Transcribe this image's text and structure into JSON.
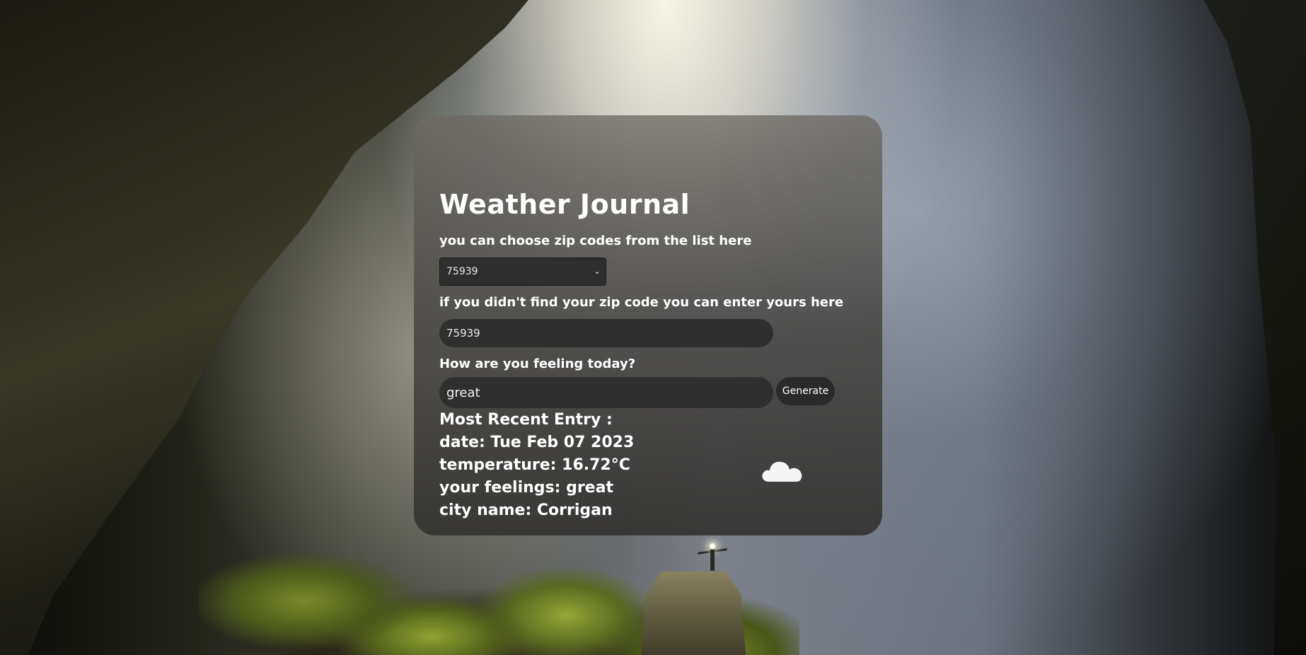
{
  "app": {
    "title": "Weather Journal"
  },
  "zip_list": {
    "label": "you can choose zip codes from the list here",
    "selected": "75939"
  },
  "zip_entry": {
    "label": "if you didn't find your zip code you can enter yours here",
    "value": "75939"
  },
  "feelings": {
    "label": "How are you feeling today?",
    "value": "great",
    "button_label": "Generate"
  },
  "recent_entry": {
    "heading": "Most Recent Entry :",
    "date_line": "date: Tue Feb 07 2023",
    "temp_line": "temperature: 16.72°C",
    "feelings_line": "your feelings: great",
    "city_line": "city name: Corrigan",
    "weather_icon": "cloud-icon"
  },
  "colors": {
    "card_bg": "#4a4845",
    "input_bg": "#2f2f2f",
    "text": "#ffffff"
  }
}
